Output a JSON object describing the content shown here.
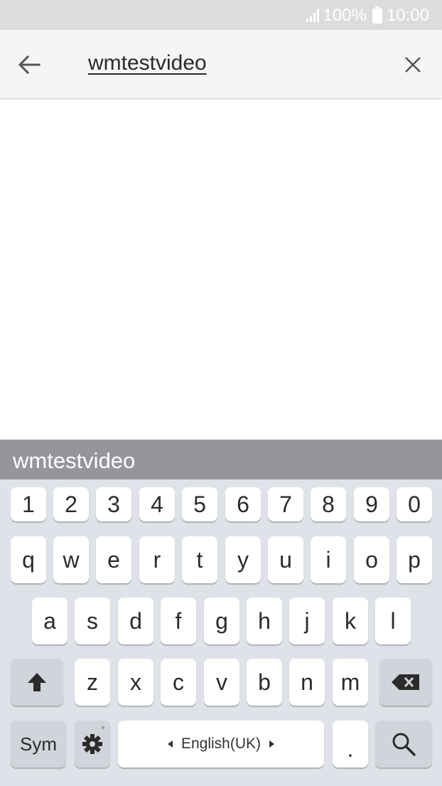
{
  "status_bar": {
    "battery_text": "100%",
    "time": "10:00",
    "icons": [
      "signal-icon",
      "battery-icon"
    ]
  },
  "search": {
    "query": "wmtestvideo",
    "back_icon": "arrow-left-icon",
    "clear_icon": "close-icon"
  },
  "suggestions": [
    "wmtestvideo"
  ],
  "keyboard": {
    "number_row": [
      "1",
      "2",
      "3",
      "4",
      "5",
      "6",
      "7",
      "8",
      "9",
      "0"
    ],
    "row1": [
      "q",
      "w",
      "e",
      "r",
      "t",
      "y",
      "u",
      "i",
      "o",
      "p"
    ],
    "row2": [
      "a",
      "s",
      "d",
      "f",
      "g",
      "h",
      "j",
      "k",
      "l"
    ],
    "row3": [
      "z",
      "x",
      "c",
      "v",
      "b",
      "n",
      "m"
    ],
    "sym_label": "Sym",
    "space_label": "English(UK)",
    "period_label": ".",
    "icons": [
      "shift-icon",
      "backspace-icon",
      "settings-gear-icon",
      "search-icon"
    ]
  },
  "colors": {
    "status_bar_bg": "#dcdcdc",
    "search_bar_bg": "#f5f5f5",
    "suggestion_bar_bg": "#94969b",
    "keyboard_bg": "#dfe2e8",
    "key_bg": "#ffffff",
    "function_key_bg": "#d1d4db"
  }
}
